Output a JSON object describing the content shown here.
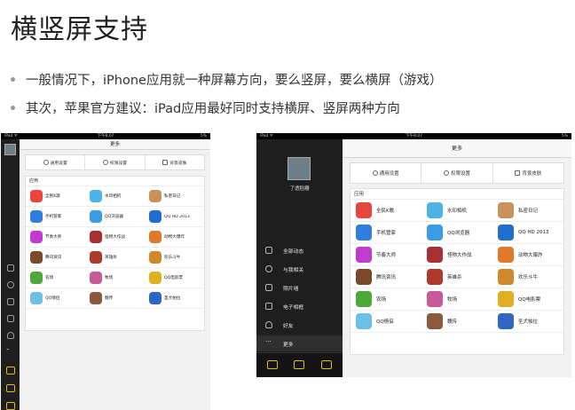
{
  "slide": {
    "title": "横竖屏支持",
    "bullets": [
      "一般情况下，iPhone应用就一种屏幕方向，要么竖屏，要么横屏（游戏）",
      "其次，苹果官方建议：iPad应用最好同时支持横屏、竖屏两种方向"
    ]
  },
  "colors": {
    "accent": "#e0c000",
    "sidebar_bg": "#1e1e1e",
    "content_bg": "#f2f2f2"
  },
  "ipad": {
    "status_left": "iPad ᯤ",
    "status_time": "下午8:07",
    "status_right": "5%",
    "nav_title": "更多",
    "segments": [
      {
        "label": "通用设置",
        "icon": "gear-icon"
      },
      {
        "label": "权限设置",
        "icon": "lock-icon"
      },
      {
        "label": "背景皮肤",
        "icon": "shirt-icon"
      }
    ],
    "apps_section_title": "应用",
    "apps": [
      {
        "label": "全民K歌",
        "icon": "karaoke-app-icon",
        "color": "#e8463c"
      },
      {
        "label": "水印相机",
        "icon": "camera-app-icon",
        "color": "#4bb3e6"
      },
      {
        "label": "私密日记",
        "icon": "diary-app-icon",
        "color": "#c9925a"
      },
      {
        "label": "手机管家",
        "icon": "shield-app-icon",
        "color": "#2f7de0"
      },
      {
        "label": "QQ浏览器",
        "icon": "browser-app-icon",
        "color": "#3a9be8"
      },
      {
        "label": "QQ HD 2013",
        "icon": "qq-app-icon",
        "color": "#1f6fd1"
      },
      {
        "label": "节奏大师",
        "icon": "music-app-icon",
        "color": "#c23ad0"
      },
      {
        "label": "怪物大作战",
        "icon": "monster-app-icon",
        "color": "#a83030"
      },
      {
        "label": "动物大爆炸",
        "icon": "animal-app-icon",
        "color": "#e07a2a"
      },
      {
        "label": "腾讯资讯",
        "icon": "news-app-icon",
        "color": "#7a4a2a"
      },
      {
        "label": "英雄杀",
        "icon": "hero-app-icon",
        "color": "#b03a2a"
      },
      {
        "label": "欢乐斗牛",
        "icon": "bull-app-icon",
        "color": "#d0882a"
      },
      {
        "label": "农场",
        "icon": "farm-app-icon",
        "color": "#4ca838"
      },
      {
        "label": "牧场",
        "icon": "ranch-app-icon",
        "color": "#c85a9a"
      },
      {
        "label": "QQ电影票",
        "icon": "movie-app-icon",
        "color": "#e0b020"
      },
      {
        "label": "QQ情侣",
        "icon": "couple-app-icon",
        "color": "#6ac0e8"
      },
      {
        "label": "魏传",
        "icon": "wei-app-icon",
        "color": "#8a5a3a"
      },
      {
        "label": "圣犬帕拉",
        "icon": "dog-app-icon",
        "color": "#2e66c8"
      }
    ]
  },
  "landscape": {
    "username": "了透稻糟",
    "menu": [
      {
        "label": "全部动态",
        "icon": "star-icon"
      },
      {
        "label": "与我相关",
        "icon": "at-icon"
      },
      {
        "label": "照片墙",
        "icon": "photo-icon"
      },
      {
        "label": "电子相框",
        "icon": "frame-icon"
      },
      {
        "label": "好友",
        "icon": "friends-icon"
      },
      {
        "label": "更多",
        "icon": "more-icon"
      }
    ]
  }
}
